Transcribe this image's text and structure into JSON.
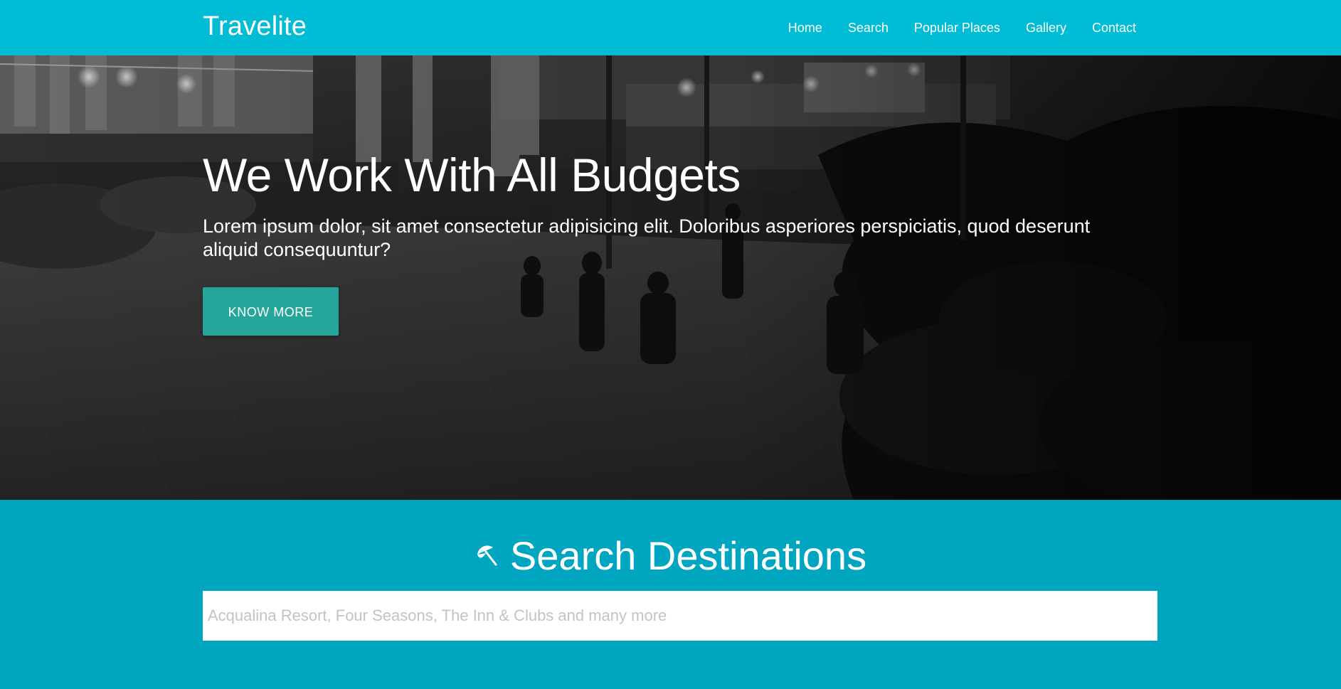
{
  "navbar": {
    "brand": "Travelite",
    "links": [
      "Home",
      "Search",
      "Popular Places",
      "Gallery",
      "Contact"
    ]
  },
  "hero": {
    "title": "We Work With All Budgets",
    "text": "Lorem ipsum dolor, sit amet consectetur adipisicing elit. Doloribus asperiores perspiciatis, quod deserunt aliquid consequuntur?",
    "button_label": "KNOW MORE"
  },
  "search": {
    "icon": "beach-umbrella-icon",
    "title": "Search Destinations",
    "placeholder": "Acqualina Resort, Four Seasons, The Inn & Clubs and many more"
  },
  "colors": {
    "navbar": "#00bcd4",
    "search_section": "#00a6c0",
    "button": "#26a69a"
  }
}
